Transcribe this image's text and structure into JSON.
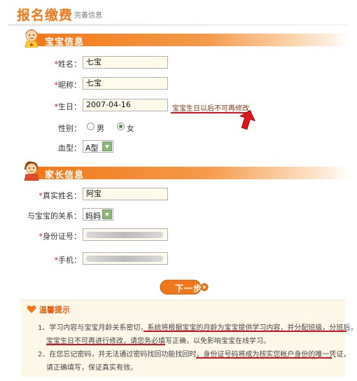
{
  "header": {
    "title": "报名缴费",
    "subtitle": "完善信息"
  },
  "baby_section": {
    "title": "宝宝信息",
    "name": {
      "label": "姓名：",
      "value": "七宝"
    },
    "nickname": {
      "label": "昵称：",
      "value": "七宝"
    },
    "birthday": {
      "label": "生日：",
      "value": "2007-04-16",
      "note": "宝宝生日以后不可再修改"
    },
    "gender": {
      "label": "性别：",
      "options": [
        "男",
        "女"
      ],
      "selected": "女"
    },
    "blood_type": {
      "label": "血型：",
      "value": "A型"
    }
  },
  "parent_section": {
    "title": "家长信息",
    "real_name": {
      "label": "真实姓名：",
      "value": "阿宝"
    },
    "relation": {
      "label": "与宝宝的关系：",
      "value": "妈妈"
    },
    "id_number": {
      "label": "身份证号："
    },
    "mobile": {
      "label": "手机："
    }
  },
  "actions": {
    "next_label": "下一步"
  },
  "tips": {
    "title": "温馨提示",
    "lines": [
      "1、学习内容与宝宝月龄关系密切，系统将根据宝宝的月龄为宝宝提供学习内容，并分配班级，分班后，",
      "宝宝生日不可再进行修改，请您务必填写正确，以免影响宝宝在线学习。",
      "2、在您忘记密码，并无法通过密码找回功能找回时，身份证号码将成为核实您帐户身份的唯一凭证，",
      "请正确填写，保证真实有效。"
    ]
  },
  "colors": {
    "accent": "#f07818",
    "required": "#e01010",
    "field_bg": "#fffbea",
    "tips_bg": "#fdf7e8",
    "underline": "#d4141c"
  }
}
